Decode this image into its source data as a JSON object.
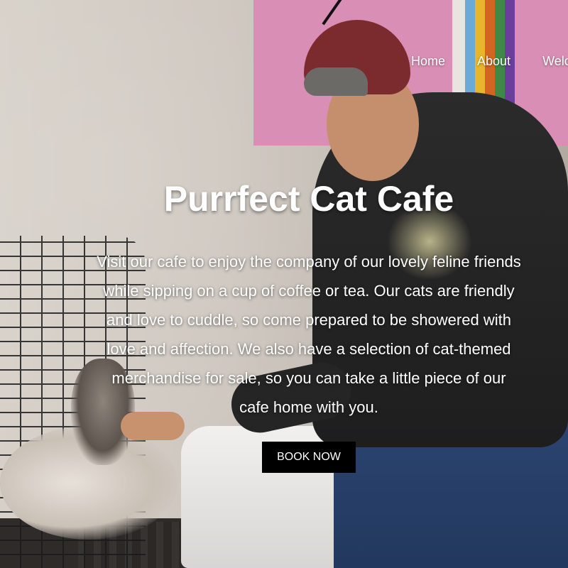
{
  "nav": {
    "items": [
      {
        "label": "Home"
      },
      {
        "label": "About"
      },
      {
        "label": "Welco"
      }
    ]
  },
  "hero": {
    "title": "Purrfect Cat Cafe",
    "description": "Visit our cafe to enjoy the company of our lovely feline friends while sipping on a cup of coffee or tea. Our cats are friendly and love to cuddle, so come prepared to be showered with love and affection. We also have a selection of cat-themed merchandise for sale, so you can take a little piece of our cafe home with you.",
    "button_label": "BOOK NOW"
  },
  "colors": {
    "text": "#ffffff",
    "button_background": "#000000",
    "art_pink": "#d98fb5"
  }
}
